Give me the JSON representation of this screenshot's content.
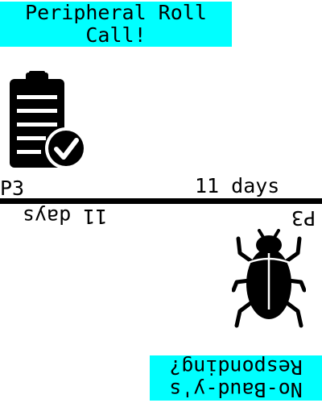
{
  "card": {
    "top": {
      "title": "Peripheral Roll\nCall!",
      "icon": "clipboard-check-icon",
      "priority": "P3",
      "duration": "11 days"
    },
    "bottom": {
      "title": "No-Baud-y's\nResponding?",
      "icon": "beetle-bug-icon",
      "priority": "P3",
      "duration": "11 days"
    },
    "colors": {
      "title_background": "#00ffff",
      "ink": "#000000",
      "background": "#ffffff"
    }
  }
}
